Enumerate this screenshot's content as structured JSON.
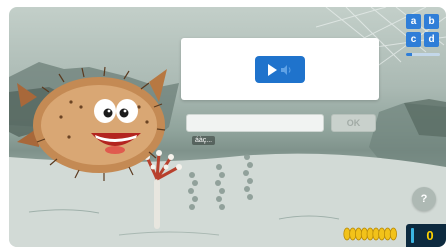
{
  "prompt": {
    "play_icon": "play-icon",
    "speaker_icon": "speaker-icon"
  },
  "answer": {
    "value": "",
    "ok_label": "OK"
  },
  "hint": {
    "text": "áàç..."
  },
  "tiles": {
    "letters": [
      "a",
      "b",
      "c",
      "d"
    ]
  },
  "level": {
    "progress_percent": 18
  },
  "help": {
    "label": "?"
  },
  "score": {
    "value": "0",
    "coin_count": 9
  },
  "colors": {
    "accent": "#2f7ed8",
    "play_button": "#1f73cc",
    "score_bg": "#0d2a3f",
    "score_text": "#ffd200"
  }
}
